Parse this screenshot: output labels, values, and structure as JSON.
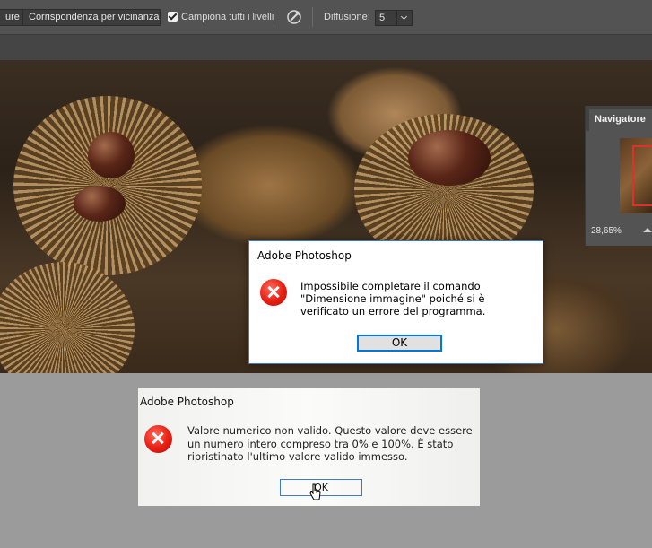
{
  "options_bar": {
    "partial_button_label": "ure",
    "proximity_match_label": "Corrispondenza per vicinanza",
    "sample_all_layers_label": "Campiona tutti i livelli",
    "sample_all_layers_checked": true,
    "brush_icon": "brush-pressure-icon",
    "diffusion_label": "Diffusione:",
    "diffusion_value": "5",
    "chevron_icon": "chevron-down-icon"
  },
  "navigator": {
    "tab_label": "Navigatore",
    "zoom_value": "28,65%",
    "zoom_icon": "mountain-small-icon"
  },
  "dialog_main": {
    "title": "Adobe Photoshop",
    "message": "Impossibile completare il comando \"Dimensione immagine\" poiché si è verificato un errore del programma.",
    "ok_label": "OK",
    "icon": "error-icon",
    "accent": "#0078d7"
  },
  "dialog_photo": {
    "title": "Adobe Photoshop",
    "message": "Valore numerico non valido. Questo valore deve essere un numero intero compreso tra 0% e 100%. È stato ripristinato l'ultimo valore valido immesso.",
    "ok_label": "OK",
    "icon": "error-icon"
  },
  "colors": {
    "ui_panel": "#535353",
    "workspace": "#9b9b9b",
    "error_red": "#e81e12"
  }
}
